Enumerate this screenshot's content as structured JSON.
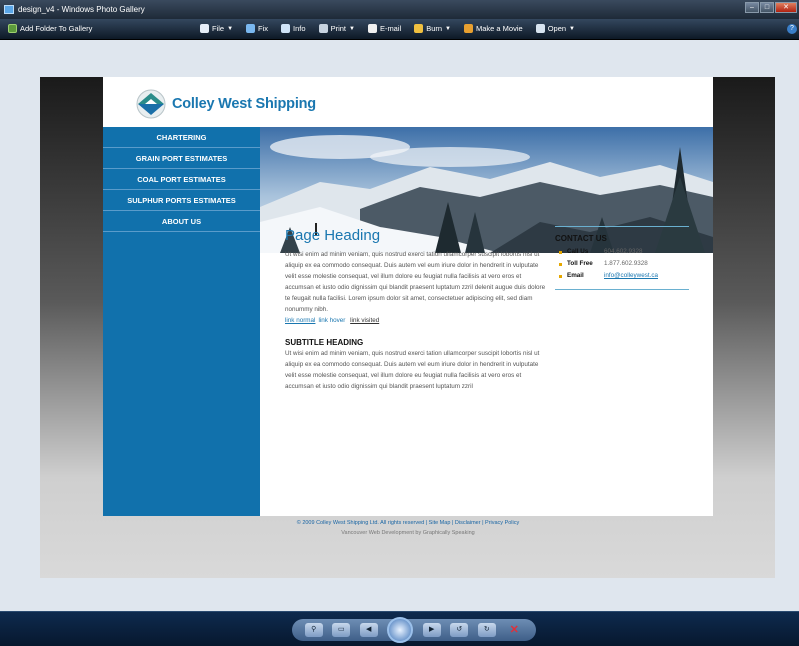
{
  "window": {
    "title": "design_v4 - Windows Photo Gallery"
  },
  "menubar": {
    "add_folder": "Add Folder To Gallery",
    "items": [
      {
        "label": "File",
        "icon": "file-icon",
        "has_menu": true,
        "color": "#e6eef8"
      },
      {
        "label": "Fix",
        "icon": "fix-icon",
        "has_menu": false,
        "color": "#7ab8f0"
      },
      {
        "label": "Info",
        "icon": "info-icon",
        "has_menu": false,
        "color": "#d0e4f8"
      },
      {
        "label": "Print",
        "icon": "print-icon",
        "has_menu": true,
        "color": "#c8d4e0"
      },
      {
        "label": "E-mail",
        "icon": "email-icon",
        "has_menu": false,
        "color": "#f0f0f0"
      },
      {
        "label": "Burn",
        "icon": "burn-icon",
        "has_menu": true,
        "color": "#f0c040"
      },
      {
        "label": "Make a Movie",
        "icon": "movie-icon",
        "has_menu": false,
        "color": "#e8a030"
      },
      {
        "label": "Open",
        "icon": "open-icon",
        "has_menu": true,
        "color": "#d8e4f0"
      }
    ]
  },
  "site": {
    "brand": "Colley West Shipping",
    "nav": [
      "CHARTERING",
      "GRAIN PORT ESTIMATES",
      "COAL PORT ESTIMATES",
      "SULPHUR PORTS ESTIMATES",
      "ABOUT US"
    ],
    "page_heading": "Page Heading",
    "paragraph1": "Ut wisi enim ad minim veniam, quis nostrud exerci tation ullamcorper suscipit lobortis nisl ut aliquip ex ea commodo consequat. Duis autem vel eum iriure dolor in hendrerit in vulputate velit esse molestie consequat, vel illum dolore eu feugiat nulla facilisis at vero eros et accumsan et iusto odio dignissim qui blandit praesent luptatum zzril delenit augue duis dolore te feugait nulla facilisi. Lorem ipsum dolor sit amet, consectetuer adipiscing elit, sed diam nonummy nibh.",
    "link_normal": "link normal",
    "link_hover": "link hover",
    "link_visited": "link visited",
    "subtitle_heading": "SUBTITLE HEADING",
    "paragraph2": "Ut wisi enim ad minim veniam, quis nostrud exerci tation ullamcorper suscipit lobortis nisl ut aliquip ex ea commodo consequat. Duis autem vel eum iriure dolor in hendrerit in vulputate velit esse molestie consequat, vel illum dolore eu feugiat nulla facilisis at vero eros et accumsan et iusto odio dignissim qui blandit praesent luptatum zzril",
    "contact": {
      "title": "CONTACT US",
      "rows": [
        {
          "label": "Call Us",
          "value": "604.602.9328"
        },
        {
          "label": "Toll Free",
          "value": "1.877.602.9328"
        },
        {
          "label": "Email",
          "value": "info@colleywest.ca"
        }
      ]
    },
    "footer_line1": "© 2009 Colley West Shipping Ltd.  All rights reserved  |  Site Map  |  Disclaimer  |  Privacy Policy",
    "footer_line2": "Vancouver Web Development by Graphically Speaking",
    "colors": {
      "nav_blue": "#1171ac",
      "brand_blue": "#1a77b0",
      "bullet_gold": "#e6a800"
    }
  },
  "controls": {
    "icons": [
      "zoom-icon",
      "actual-size-icon",
      "previous-icon",
      "slideshow-icon",
      "next-icon",
      "rotate-left-icon",
      "rotate-right-icon",
      "delete-icon"
    ]
  }
}
